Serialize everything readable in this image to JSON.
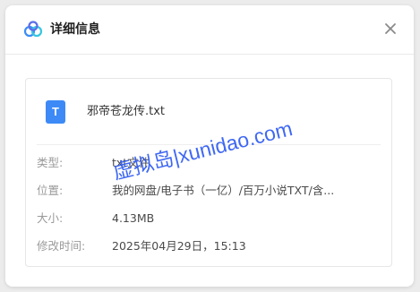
{
  "dialog": {
    "title": "详细信息",
    "close_icon": "close-icon",
    "logo_icon": "cloud-logo-icon"
  },
  "file": {
    "icon_letter": "T",
    "icon_color": "#3d8af7",
    "name": "邪帝苍龙传.txt"
  },
  "details": [
    {
      "label": "类型:",
      "value": "txt文件"
    },
    {
      "label": "位置:",
      "value": "我的网盘/电子书（一亿）/百万小说TXT/含..."
    },
    {
      "label": "大小:",
      "value": "4.13MB"
    },
    {
      "label": "修改时间:",
      "value": "2025年04月29日，15:13"
    }
  ],
  "watermark": {
    "text": "虚拟岛|xunidao.com",
    "color": "#2f5cf2"
  }
}
